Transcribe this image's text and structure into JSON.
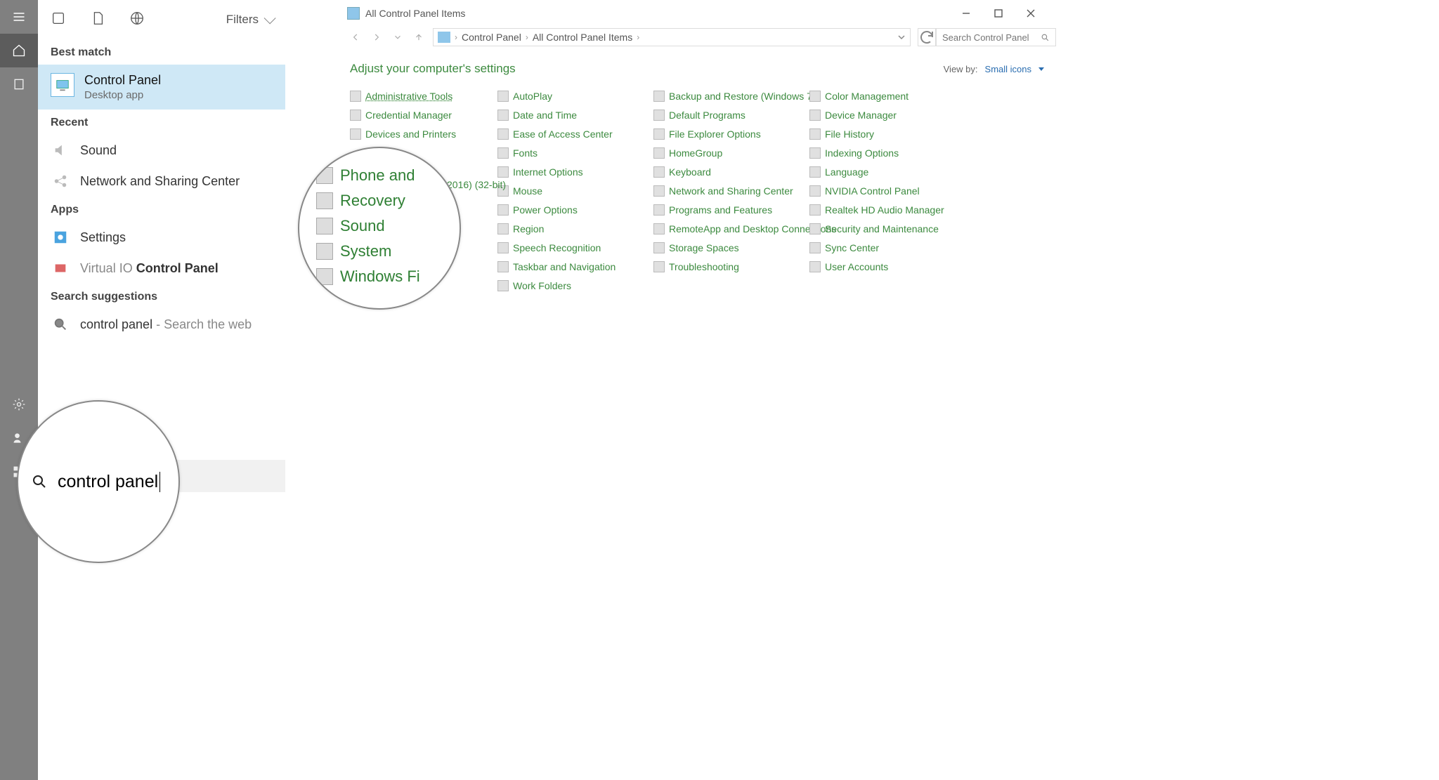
{
  "sidebar": {},
  "search": {
    "filters_label": "Filters",
    "sections": {
      "best_match": "Best match",
      "recent": "Recent",
      "apps": "Apps",
      "suggestions": "Search suggestions"
    },
    "best": {
      "title": "Control Panel",
      "subtitle": "Desktop app"
    },
    "recent": [
      {
        "label": "Sound"
      },
      {
        "label": "Network and Sharing Center"
      }
    ],
    "apps": [
      {
        "label": "Settings"
      },
      {
        "label_prefix": "Virtual IO ",
        "label_bold": "Control Panel"
      }
    ],
    "suggestion": {
      "query": "control panel",
      "tail": " - Search the web"
    },
    "input_value": "control panel"
  },
  "bubble_lower_text": "control panel",
  "bubble_mid": [
    "Phone and",
    "Recovery",
    "Sound",
    "System",
    "Windows Fi"
  ],
  "stray_text": "2016) (32-bit)",
  "cp": {
    "title": "All Control Panel Items",
    "crumbs": [
      "Control Panel",
      "All Control Panel Items"
    ],
    "search_placeholder": "Search Control Panel",
    "adjust": "Adjust your computer's settings",
    "viewby_label": "View by:",
    "viewby_value": "Small icons",
    "items": [
      [
        "Administrative Tools",
        "AutoPlay",
        "Backup and Restore (Windows 7)",
        "Color Management"
      ],
      [
        "Credential Manager",
        "Date and Time",
        "Default Programs",
        "Device Manager"
      ],
      [
        "Devices and Printers",
        "Ease of Access Center",
        "File Explorer Options",
        "File History"
      ],
      [
        "",
        "Fonts",
        "HomeGroup",
        "Indexing Options"
      ],
      [
        "",
        "Internet Options",
        "Keyboard",
        "Language"
      ],
      [
        "",
        "Mouse",
        "Network and Sharing Center",
        "NVIDIA Control Panel"
      ],
      [
        "",
        "Power Options",
        "Programs and Features",
        "Realtek HD Audio Manager"
      ],
      [
        "",
        "Region",
        "RemoteApp and Desktop Connections",
        "Security and Maintenance"
      ],
      [
        "",
        "Speech Recognition",
        "Storage Spaces",
        "Sync Center"
      ],
      [
        "",
        "Taskbar and Navigation",
        "Troubleshooting",
        "User Accounts"
      ],
      [
        "",
        "Work Folders",
        "",
        ""
      ]
    ]
  }
}
